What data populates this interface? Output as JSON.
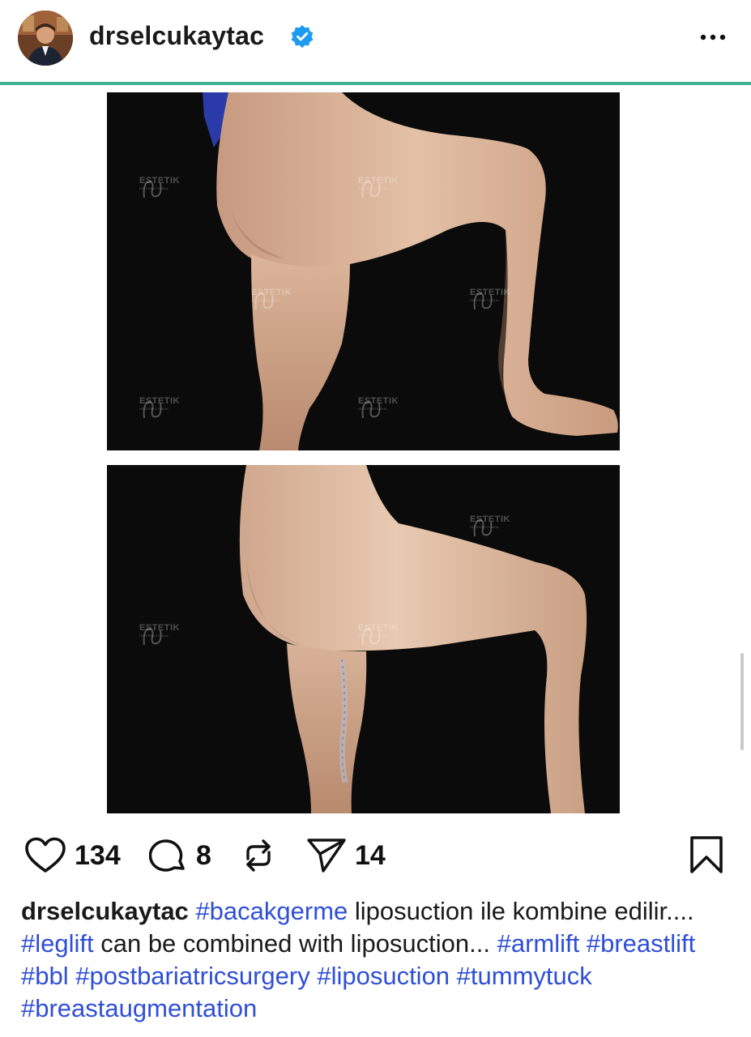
{
  "post": {
    "username": "drselcukaytac",
    "verified": true,
    "more_icon": "more-horizontal-icon"
  },
  "images": [
    {
      "label": "before-photo",
      "watermark": "ESTETIK",
      "watermark_sub": "INTERNATIONAL"
    },
    {
      "label": "after-photo",
      "watermark": "ESTETIK",
      "watermark_sub": "INTERNATIONAL"
    }
  ],
  "actions": {
    "like_count": "134",
    "comment_count": "8",
    "share_count": "14"
  },
  "caption": {
    "username": "drselcukaytac",
    "segments": [
      {
        "type": "tag",
        "text": "#bacakgerme"
      },
      {
        "type": "text",
        "text": " liposuction ile kombine edilir.... "
      },
      {
        "type": "tag",
        "text": "#leglift"
      },
      {
        "type": "text",
        "text": " can be combined with liposuction... "
      },
      {
        "type": "tag",
        "text": "#armlift"
      },
      {
        "type": "text",
        "text": " "
      },
      {
        "type": "tag",
        "text": "#breastlift"
      },
      {
        "type": "text",
        "text": " "
      },
      {
        "type": "tag",
        "text": "#bbl"
      },
      {
        "type": "text",
        "text": " "
      },
      {
        "type": "tag",
        "text": "#postbariatricsurgery"
      },
      {
        "type": "text",
        "text": " "
      },
      {
        "type": "tag",
        "text": "#liposuction"
      },
      {
        "type": "text",
        "text": " "
      },
      {
        "type": "tag",
        "text": "#tummytuck"
      },
      {
        "type": "text",
        "text": " "
      },
      {
        "type": "tag",
        "text": "#breastaugmentation"
      }
    ]
  },
  "colors": {
    "accent_divider": "#3db393",
    "hashtag": "#2f4fd6",
    "verified": "#1d9bf0"
  }
}
